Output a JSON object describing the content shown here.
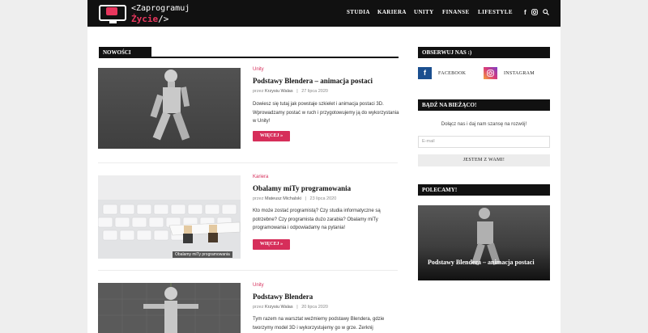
{
  "header": {
    "logo_line1": "<Zaprogramuj",
    "logo_line2": "Życie",
    "logo_line2_tail": "/>",
    "nav": [
      "STUDIA",
      "KARIERA",
      "UNITY",
      "FINANSE",
      "LIFESTYLE"
    ],
    "icons": [
      "facebook-icon",
      "instagram-icon",
      "search-icon"
    ]
  },
  "main": {
    "section_title": "NOWOŚCI",
    "posts": [
      {
        "category": "Unity",
        "title": "Podstawy Blendera – animacja postaci",
        "meta_prefix": "przez",
        "author": "Krzysiu Walas",
        "sep": "|",
        "date": "27 lipca 2020",
        "excerpt": "Dowiesz się tutaj jak powstaje szkielet i animacja postaci 3D. Wprowadzamy postać w ruch i przygotowujemy ją do wykorzystania w Unity!",
        "more": "WIĘCEJ »"
      },
      {
        "category": "Kariera",
        "title": "Obalamy miTy programowania",
        "meta_prefix": "przez",
        "author": "Mateusz Michalski",
        "sep": "|",
        "date": "23 lipca 2020",
        "excerpt": "Kto może zostać programistą? Czy studia informatyczne są potrzebne? Czy programista dużo zarabia? Obalamy miTy programowania i odpowiadamy na pytania!",
        "more": "WIĘCEJ »",
        "image_caption": "Obalamy miTy programowania"
      },
      {
        "category": "Unity",
        "title": "Podstawy Blendera",
        "meta_prefix": "przez",
        "author": "Krzysiu Walas",
        "sep": "|",
        "date": "20 lipca 2020",
        "excerpt": "Tym razem na warsztat weźmiemy podstawy Blendera, gdzie tworzymy model 3D i wykorzystujemy go w grze. Zerknij"
      }
    ]
  },
  "sidebar": {
    "follow_title": "OBSERWUJ NAS :)",
    "facebook_label": "FACEBOOK",
    "instagram_label": "INSTAGRAM",
    "newsletter_title": "BĄDŹ NA BIEŻĄCO!",
    "newsletter_text": "Dołącz nas i daj nam szansę na rozwój!",
    "email_placeholder": "E-mail",
    "subscribe_label": "JESTEM Z WAMI!",
    "recommended_title": "POLECAMY!",
    "recommended_caption": "Podstawy Blendera – animacja postaci"
  },
  "colors": {
    "accent": "#d62e5a",
    "dark": "#111111",
    "facebook": "#1b4f8f"
  }
}
